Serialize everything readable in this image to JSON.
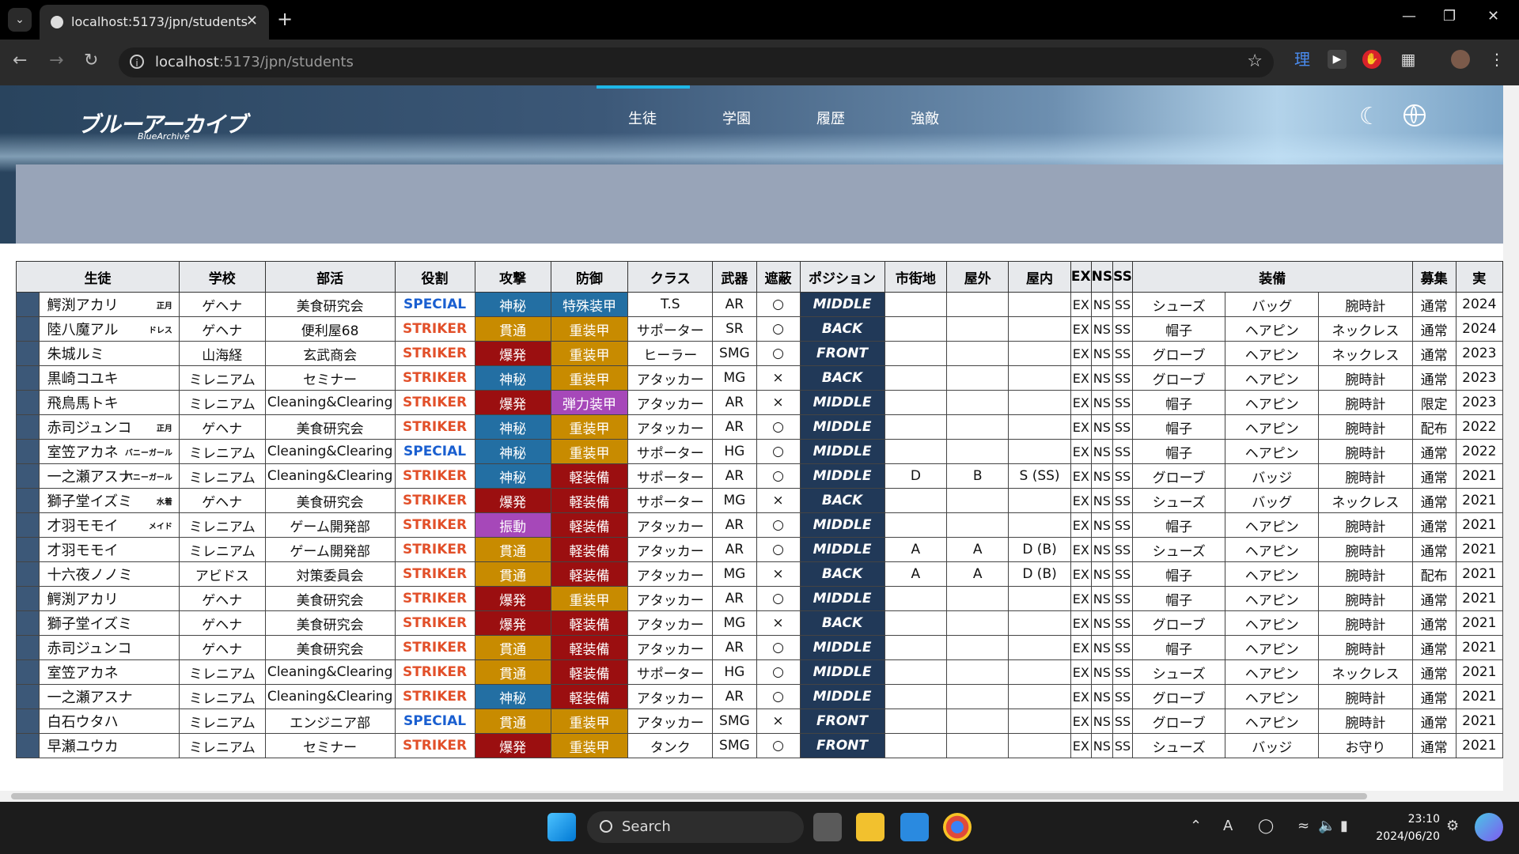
{
  "browser": {
    "tab_title": "localhost:5173/jpn/students",
    "url_host": "localhost",
    "url_path": ":5173/jpn/students",
    "ext_label": "理"
  },
  "site": {
    "logo_text": "ブルーアーカイブ",
    "logo_sub": "BlueArchive",
    "nav": [
      "生徒",
      "学園",
      "履歴",
      "強敵"
    ],
    "active_nav": "生徒"
  },
  "colors": {
    "special": "#1a5fd0",
    "striker": "#e2502a",
    "attack": {
      "神秘": "#236fa3",
      "貫通": "#c88b00",
      "爆発": "#9b0f10",
      "振動": "#a648b9"
    },
    "armor": {
      "特殊装甲": "#236fa3",
      "重装甲": "#c88b00",
      "軽装備": "#9b0f10",
      "弾力装甲": "#a648b9"
    }
  },
  "table": {
    "headers": [
      "生徒",
      "学校",
      "部活",
      "役割",
      "攻撃",
      "防御",
      "クラス",
      "武器",
      "遮蔽",
      "ポジション",
      "市街地",
      "屋外",
      "屋内",
      "EX",
      "NS",
      "SS",
      "装備",
      "募集",
      "実"
    ],
    "rows": [
      {
        "name": "鰐渕アカリ",
        "variant": "正月",
        "school": "ゲヘナ",
        "club": "美食研究会",
        "role": "SPECIAL",
        "attack": "神秘",
        "armor": "特殊装甲",
        "cls": "T.S",
        "weapon": "AR",
        "cover": "○",
        "position": "MIDDLE",
        "urban": "",
        "outdoor": "",
        "indoor": "",
        "ex": "EX",
        "ns": "NS",
        "ss": "SS",
        "eq1": "シューズ",
        "eq2": "バッグ",
        "eq3": "腕時計",
        "recruit": "通常",
        "impl": "2024"
      },
      {
        "name": "陸八魔アル",
        "variant": "ドレス",
        "school": "ゲヘナ",
        "club": "便利屋68",
        "role": "STRIKER",
        "attack": "貫通",
        "armor": "重装甲",
        "cls": "サポーター",
        "weapon": "SR",
        "cover": "○",
        "position": "BACK",
        "urban": "",
        "outdoor": "",
        "indoor": "",
        "ex": "EX",
        "ns": "NS",
        "ss": "SS",
        "eq1": "帽子",
        "eq2": "ヘアピン",
        "eq3": "ネックレス",
        "recruit": "通常",
        "impl": "2024"
      },
      {
        "name": "朱城ルミ",
        "variant": "",
        "school": "山海経",
        "club": "玄武商会",
        "role": "STRIKER",
        "attack": "爆発",
        "armor": "重装甲",
        "cls": "ヒーラー",
        "weapon": "SMG",
        "cover": "○",
        "position": "FRONT",
        "urban": "",
        "outdoor": "",
        "indoor": "",
        "ex": "EX",
        "ns": "NS",
        "ss": "SS",
        "eq1": "グローブ",
        "eq2": "ヘアピン",
        "eq3": "ネックレス",
        "recruit": "通常",
        "impl": "2023"
      },
      {
        "name": "黒崎コユキ",
        "variant": "",
        "school": "ミレニアム",
        "club": "セミナー",
        "role": "STRIKER",
        "attack": "神秘",
        "armor": "重装甲",
        "cls": "アタッカー",
        "weapon": "MG",
        "cover": "×",
        "position": "BACK",
        "urban": "",
        "outdoor": "",
        "indoor": "",
        "ex": "EX",
        "ns": "NS",
        "ss": "SS",
        "eq1": "グローブ",
        "eq2": "ヘアピン",
        "eq3": "腕時計",
        "recruit": "通常",
        "impl": "2023"
      },
      {
        "name": "飛鳥馬トキ",
        "variant": "",
        "school": "ミレニアム",
        "club": "Cleaning&Clearing",
        "role": "STRIKER",
        "attack": "爆発",
        "armor": "弾力装甲",
        "cls": "アタッカー",
        "weapon": "AR",
        "cover": "×",
        "position": "MIDDLE",
        "urban": "",
        "outdoor": "",
        "indoor": "",
        "ex": "EX",
        "ns": "NS",
        "ss": "SS",
        "eq1": "帽子",
        "eq2": "ヘアピン",
        "eq3": "腕時計",
        "recruit": "限定",
        "impl": "2023"
      },
      {
        "name": "赤司ジュンコ",
        "variant": "正月",
        "school": "ゲヘナ",
        "club": "美食研究会",
        "role": "STRIKER",
        "attack": "神秘",
        "armor": "重装甲",
        "cls": "アタッカー",
        "weapon": "AR",
        "cover": "○",
        "position": "MIDDLE",
        "urban": "",
        "outdoor": "",
        "indoor": "",
        "ex": "EX",
        "ns": "NS",
        "ss": "SS",
        "eq1": "帽子",
        "eq2": "ヘアピン",
        "eq3": "腕時計",
        "recruit": "配布",
        "impl": "2022"
      },
      {
        "name": "室笠アカネ",
        "variant": "バニーガール",
        "school": "ミレニアム",
        "club": "Cleaning&Clearing",
        "role": "SPECIAL",
        "attack": "神秘",
        "armor": "重装甲",
        "cls": "サポーター",
        "weapon": "HG",
        "cover": "○",
        "position": "MIDDLE",
        "urban": "",
        "outdoor": "",
        "indoor": "",
        "ex": "EX",
        "ns": "NS",
        "ss": "SS",
        "eq1": "帽子",
        "eq2": "ヘアピン",
        "eq3": "腕時計",
        "recruit": "通常",
        "impl": "2022"
      },
      {
        "name": "一之瀬アスナ",
        "variant": "バニーガール",
        "school": "ミレニアム",
        "club": "Cleaning&Clearing",
        "role": "STRIKER",
        "attack": "神秘",
        "armor": "軽装備",
        "cls": "サポーター",
        "weapon": "AR",
        "cover": "○",
        "position": "MIDDLE",
        "urban": "D",
        "outdoor": "B",
        "indoor": "S (SS)",
        "ex": "EX",
        "ns": "NS",
        "ss": "SS",
        "eq1": "グローブ",
        "eq2": "バッジ",
        "eq3": "腕時計",
        "recruit": "通常",
        "impl": "2021"
      },
      {
        "name": "獅子堂イズミ",
        "variant": "水着",
        "school": "ゲヘナ",
        "club": "美食研究会",
        "role": "STRIKER",
        "attack": "爆発",
        "armor": "軽装備",
        "cls": "サポーター",
        "weapon": "MG",
        "cover": "×",
        "position": "BACK",
        "urban": "",
        "outdoor": "",
        "indoor": "",
        "ex": "EX",
        "ns": "NS",
        "ss": "SS",
        "eq1": "シューズ",
        "eq2": "バッグ",
        "eq3": "ネックレス",
        "recruit": "通常",
        "impl": "2021"
      },
      {
        "name": "才羽モモイ",
        "variant": "メイド",
        "school": "ミレニアム",
        "club": "ゲーム開発部",
        "role": "STRIKER",
        "attack": "振動",
        "armor": "軽装備",
        "cls": "アタッカー",
        "weapon": "AR",
        "cover": "○",
        "position": "MIDDLE",
        "urban": "",
        "outdoor": "",
        "indoor": "",
        "ex": "EX",
        "ns": "NS",
        "ss": "SS",
        "eq1": "帽子",
        "eq2": "ヘアピン",
        "eq3": "腕時計",
        "recruit": "通常",
        "impl": "2021"
      },
      {
        "name": "才羽モモイ",
        "variant": "",
        "school": "ミレニアム",
        "club": "ゲーム開発部",
        "role": "STRIKER",
        "attack": "貫通",
        "armor": "軽装備",
        "cls": "アタッカー",
        "weapon": "AR",
        "cover": "○",
        "position": "MIDDLE",
        "urban": "A",
        "outdoor": "A",
        "indoor": "D (B)",
        "ex": "EX",
        "ns": "NS",
        "ss": "SS",
        "eq1": "シューズ",
        "eq2": "ヘアピン",
        "eq3": "腕時計",
        "recruit": "通常",
        "impl": "2021"
      },
      {
        "name": "十六夜ノノミ",
        "variant": "",
        "school": "アビドス",
        "club": "対策委員会",
        "role": "STRIKER",
        "attack": "貫通",
        "armor": "軽装備",
        "cls": "アタッカー",
        "weapon": "MG",
        "cover": "×",
        "position": "BACK",
        "urban": "A",
        "outdoor": "A",
        "indoor": "D (B)",
        "ex": "EX",
        "ns": "NS",
        "ss": "SS",
        "eq1": "帽子",
        "eq2": "ヘアピン",
        "eq3": "腕時計",
        "recruit": "配布",
        "impl": "2021"
      },
      {
        "name": "鰐渕アカリ",
        "variant": "",
        "school": "ゲヘナ",
        "club": "美食研究会",
        "role": "STRIKER",
        "attack": "爆発",
        "armor": "重装甲",
        "cls": "アタッカー",
        "weapon": "AR",
        "cover": "○",
        "position": "MIDDLE",
        "urban": "",
        "outdoor": "",
        "indoor": "",
        "ex": "EX",
        "ns": "NS",
        "ss": "SS",
        "eq1": "帽子",
        "eq2": "ヘアピン",
        "eq3": "腕時計",
        "recruit": "通常",
        "impl": "2021"
      },
      {
        "name": "獅子堂イズミ",
        "variant": "",
        "school": "ゲヘナ",
        "club": "美食研究会",
        "role": "STRIKER",
        "attack": "爆発",
        "armor": "軽装備",
        "cls": "アタッカー",
        "weapon": "MG",
        "cover": "×",
        "position": "BACK",
        "urban": "",
        "outdoor": "",
        "indoor": "",
        "ex": "EX",
        "ns": "NS",
        "ss": "SS",
        "eq1": "グローブ",
        "eq2": "ヘアピン",
        "eq3": "腕時計",
        "recruit": "通常",
        "impl": "2021"
      },
      {
        "name": "赤司ジュンコ",
        "variant": "",
        "school": "ゲヘナ",
        "club": "美食研究会",
        "role": "STRIKER",
        "attack": "貫通",
        "armor": "軽装備",
        "cls": "アタッカー",
        "weapon": "AR",
        "cover": "○",
        "position": "MIDDLE",
        "urban": "",
        "outdoor": "",
        "indoor": "",
        "ex": "EX",
        "ns": "NS",
        "ss": "SS",
        "eq1": "帽子",
        "eq2": "ヘアピン",
        "eq3": "腕時計",
        "recruit": "通常",
        "impl": "2021"
      },
      {
        "name": "室笠アカネ",
        "variant": "",
        "school": "ミレニアム",
        "club": "Cleaning&Clearing",
        "role": "STRIKER",
        "attack": "貫通",
        "armor": "軽装備",
        "cls": "サポーター",
        "weapon": "HG",
        "cover": "○",
        "position": "MIDDLE",
        "urban": "",
        "outdoor": "",
        "indoor": "",
        "ex": "EX",
        "ns": "NS",
        "ss": "SS",
        "eq1": "シューズ",
        "eq2": "ヘアピン",
        "eq3": "ネックレス",
        "recruit": "通常",
        "impl": "2021"
      },
      {
        "name": "一之瀬アスナ",
        "variant": "",
        "school": "ミレニアム",
        "club": "Cleaning&Clearing",
        "role": "STRIKER",
        "attack": "神秘",
        "armor": "軽装備",
        "cls": "アタッカー",
        "weapon": "AR",
        "cover": "○",
        "position": "MIDDLE",
        "urban": "",
        "outdoor": "",
        "indoor": "",
        "ex": "EX",
        "ns": "NS",
        "ss": "SS",
        "eq1": "グローブ",
        "eq2": "ヘアピン",
        "eq3": "腕時計",
        "recruit": "通常",
        "impl": "2021"
      },
      {
        "name": "白石ウタハ",
        "variant": "",
        "school": "ミレニアム",
        "club": "エンジニア部",
        "role": "SPECIAL",
        "attack": "貫通",
        "armor": "重装甲",
        "cls": "アタッカー",
        "weapon": "SMG",
        "cover": "×",
        "position": "FRONT",
        "urban": "",
        "outdoor": "",
        "indoor": "",
        "ex": "EX",
        "ns": "NS",
        "ss": "SS",
        "eq1": "グローブ",
        "eq2": "ヘアピン",
        "eq3": "腕時計",
        "recruit": "通常",
        "impl": "2021"
      },
      {
        "name": "早瀬ユウカ",
        "variant": "",
        "school": "ミレニアム",
        "club": "セミナー",
        "role": "STRIKER",
        "attack": "爆発",
        "armor": "重装甲",
        "cls": "タンク",
        "weapon": "SMG",
        "cover": "○",
        "position": "FRONT",
        "urban": "",
        "outdoor": "",
        "indoor": "",
        "ex": "EX",
        "ns": "NS",
        "ss": "SS",
        "eq1": "シューズ",
        "eq2": "バッジ",
        "eq3": "お守り",
        "recruit": "通常",
        "impl": "2021"
      }
    ]
  },
  "taskbar": {
    "search_label": "Search",
    "time": "23:10",
    "date": "2024/06/20"
  }
}
